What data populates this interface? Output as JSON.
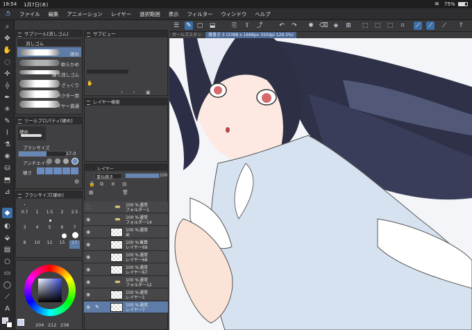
{
  "status": {
    "time": "18:54",
    "date": "1月7日(木)",
    "battery": "75%"
  },
  "menu": [
    "ファイル",
    "編集",
    "アニメーション",
    "レイヤー",
    "選択範囲",
    "表示",
    "フィルター",
    "ウィンドウ",
    "ヘルプ"
  ],
  "subtool_panel": {
    "title": "サブツール[消しゴム]",
    "tab": "消しゴム",
    "items": [
      "硬め",
      "軟らかめ",
      "練り消しゴム",
      "ざっくり",
      "ベクター用",
      "レイヤー貫通"
    ]
  },
  "subview_panel": {
    "title": "サブビュー"
  },
  "layer_search_panel": {
    "title": "レイヤー検索"
  },
  "tool_property": {
    "title": "ツールプロパティ[硬め]",
    "preset": "硬め",
    "brush_size_label": "ブラシサイズ",
    "brush_size_value": "17.0",
    "antialias_label": "アンチエイリ",
    "hardness_label": "硬さ"
  },
  "brush_size_panel": {
    "title": "ブラシサイズ[硬め]",
    "sizes": [
      "0.7",
      "1",
      "1.5",
      "2",
      "2.5",
      "3",
      "4",
      "5",
      "6",
      "7",
      "8",
      "10",
      "12",
      "15",
      "17"
    ]
  },
  "color": {
    "r": "204",
    "g": "212",
    "b": "238",
    "fg": "#ccd4ee"
  },
  "layer_panel": {
    "tab": "レイヤー",
    "blend": "重ね焼き",
    "opacity": "100",
    "layers": [
      {
        "pct": "100 %",
        "mode": "通常",
        "name": "フォルダー1",
        "kind": "folder"
      },
      {
        "pct": "100 %",
        "mode": "通常",
        "name": "フォルダー14",
        "kind": "folder"
      },
      {
        "pct": "100 %",
        "mode": "通常",
        "name": "め",
        "kind": "layer"
      },
      {
        "pct": "100 %",
        "mode": "乗算",
        "name": "レイヤー69",
        "kind": "layer"
      },
      {
        "pct": "100 %",
        "mode": "通常",
        "name": "レイヤー68",
        "kind": "layer"
      },
      {
        "pct": "100 %",
        "mode": "通常",
        "name": "レイヤー67",
        "kind": "layer"
      },
      {
        "pct": "100 %",
        "mode": "通常",
        "name": "フォルダー12",
        "kind": "folder"
      },
      {
        "pct": "100 %",
        "mode": "通常",
        "name": "レイヤー1",
        "kind": "layer"
      },
      {
        "pct": "100 %",
        "mode": "通常",
        "name": "レイヤー7",
        "kind": "layer"
      }
    ]
  },
  "document_tabs": [
    {
      "label": "ガールズスタン"
    },
    {
      "label": "落書き 3 (2388 x 1668px 350dpi 129.3%)"
    }
  ]
}
